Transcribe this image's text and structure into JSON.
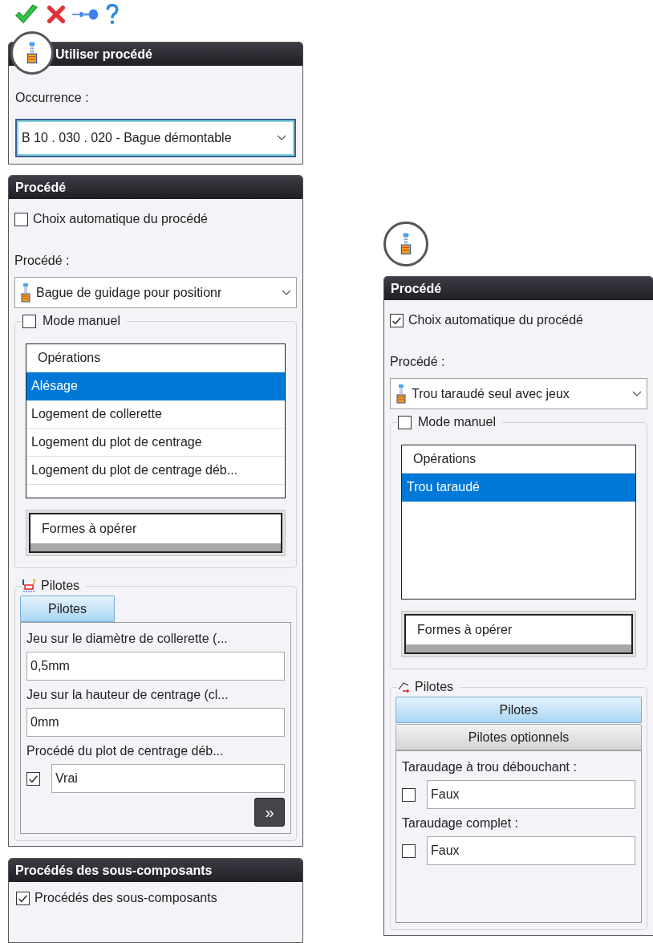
{
  "use_process": {
    "title": "Utiliser procédé",
    "occurrence_label": "Occurrence :",
    "occurrence_value": "B 10 . 030 . 020 - Bague démontable"
  },
  "left_process": {
    "title": "Procédé",
    "auto_choice": {
      "label": "Choix automatique du procédé",
      "checked": false
    },
    "process_label": "Procédé :",
    "process_value": "Bague de guidage pour positionr",
    "manual_mode": {
      "label": "Mode manuel",
      "checked": false
    },
    "operations_header": "Opérations",
    "operations": [
      {
        "label": "Alésage",
        "selected": true
      },
      {
        "label": "Logement de collerette",
        "selected": false
      },
      {
        "label": "Logement du plot de centrage",
        "selected": false
      },
      {
        "label": "Logement du plot de centrage déb...",
        "selected": false
      }
    ],
    "forms_header": "Formes à opérer",
    "pilots_label": "Pilotes",
    "tabs": [
      {
        "kind": "compact",
        "label": "Pilotes",
        "selected": true
      }
    ],
    "fields": [
      {
        "kind": "text",
        "label": "Jeu sur le diamètre de collerette (...",
        "value": "0,5mm"
      },
      {
        "kind": "text",
        "label": "Jeu sur la hauteur de centrage (cl...",
        "value": "0mm"
      },
      {
        "kind": "bool",
        "label": "Procédé du plot de centrage déb...",
        "value": "Vrai",
        "checked": true
      }
    ],
    "more_button": "»"
  },
  "subcomponents": {
    "title": "Procédés des sous-composants",
    "checkbox": {
      "label": "Procédés des sous-composants",
      "checked": true
    }
  },
  "right_process": {
    "title": "Procédé",
    "auto_choice": {
      "label": "Choix automatique du procédé",
      "checked": true
    },
    "process_label": "Procédé :",
    "process_value": "Trou taraudé seul avec jeux",
    "manual_mode": {
      "label": "Mode manuel",
      "checked": false
    },
    "operations_header": "Opérations",
    "operations": [
      {
        "label": "Trou taraudé",
        "selected": true
      }
    ],
    "forms_header": "Formes à opérer",
    "pilots_label": "Pilotes",
    "tabs": [
      {
        "kind": "full",
        "label": "Pilotes",
        "selected": true
      },
      {
        "kind": "full",
        "label": "Pilotes optionnels",
        "selected": false
      }
    ],
    "fields": [
      {
        "kind": "bool",
        "label": "Taraudage à trou débouchant :",
        "value": "Faux",
        "checked": false
      },
      {
        "kind": "bool",
        "label": "Taraudage complet :",
        "value": "Faux",
        "checked": false
      }
    ]
  }
}
